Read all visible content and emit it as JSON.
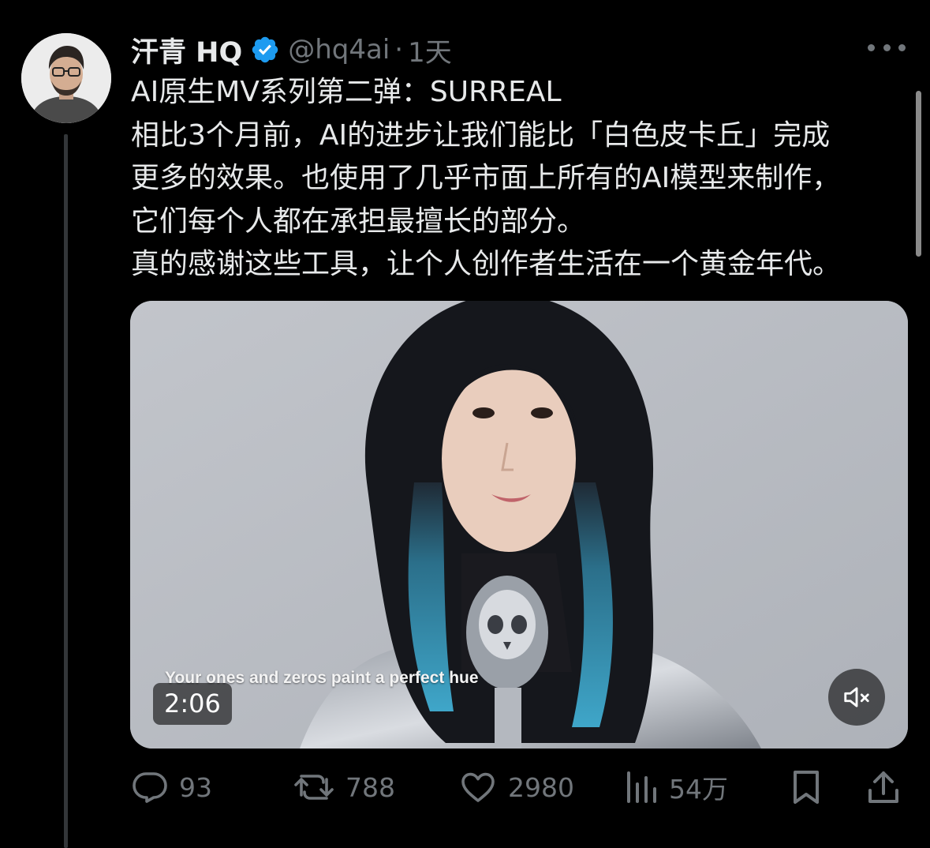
{
  "author": {
    "display_name": "汗青 HQ",
    "handle": "@hq4ai",
    "separator": "·",
    "time": "1天"
  },
  "tweet": {
    "lines": [
      "AI原生MV系列第二弹：SURREAL",
      "相比3个月前，AI的进步让我们能比「白色皮卡丘」完成",
      "更多的效果。也使用了几乎市面上所有的AI模型来制作，",
      "它们每个人都在承担最擅长的部分。",
      "真的感谢这些工具，让个人创作者生活在一个黄金年代。"
    ]
  },
  "media": {
    "caption": "Your ones and zeros paint a perfect hue",
    "duration": "2:06",
    "muted": true
  },
  "actions": {
    "replies": "93",
    "retweets": "788",
    "likes": "2980",
    "views": "54万"
  },
  "colors": {
    "background": "#000000",
    "text_primary": "#e7e9ea",
    "text_secondary": "#71767b",
    "verified": "#1d9bf0"
  },
  "icons": [
    "verified-badge-icon",
    "more-icon",
    "mute-icon",
    "reply-icon",
    "retweet-icon",
    "like-icon",
    "views-icon",
    "bookmark-icon",
    "share-icon"
  ]
}
